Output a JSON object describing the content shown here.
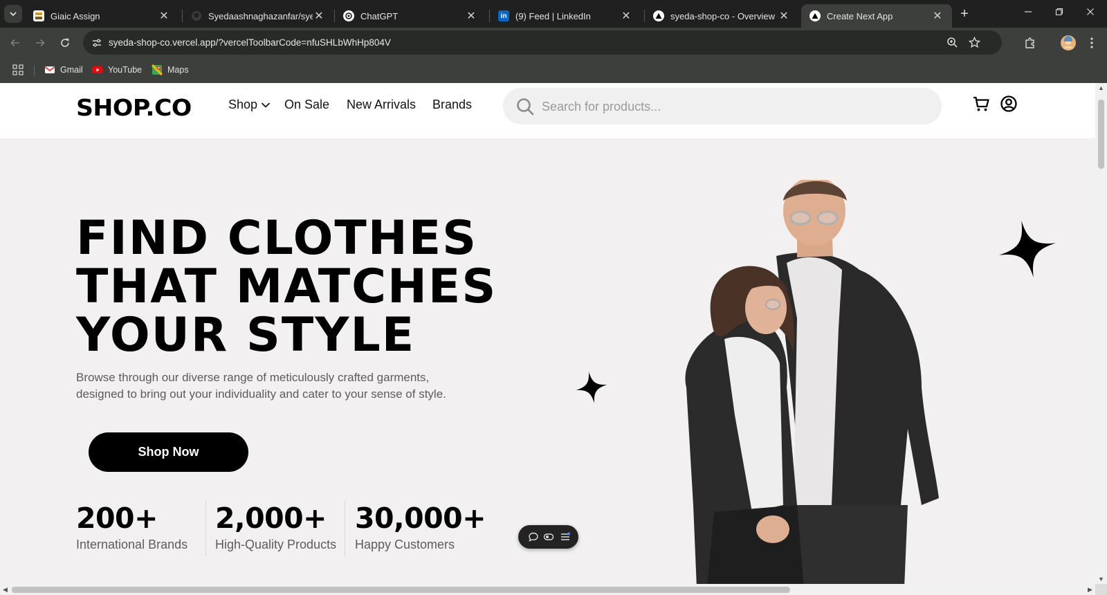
{
  "browser": {
    "tabs": [
      {
        "title": "Giaic Assign",
        "favicon": "giaic-favicon",
        "active": false
      },
      {
        "title": "Syedaashnaghazanfar/syeda-shop-co",
        "favicon": "github-favicon",
        "active": false
      },
      {
        "title": "ChatGPT",
        "favicon": "chatgpt-favicon",
        "active": false
      },
      {
        "title": "(9) Feed | LinkedIn",
        "favicon": "linkedin-favicon",
        "active": false
      },
      {
        "title": "syeda-shop-co - Overview – Vercel",
        "favicon": "vercel-favicon",
        "active": false
      },
      {
        "title": "Create Next App",
        "favicon": "vercel-favicon",
        "active": true
      }
    ],
    "url": "syeda-shop-co.vercel.app/?vercelToolbarCode=nfuSHLbWhHp804V",
    "bookmarks": [
      {
        "label": "Gmail",
        "icon": "gmail-icon"
      },
      {
        "label": "YouTube",
        "icon": "youtube-icon"
      },
      {
        "label": "Maps",
        "icon": "maps-icon"
      }
    ]
  },
  "site": {
    "logo": "SHOP.CO",
    "nav": {
      "shop": "Shop",
      "on_sale": "On Sale",
      "new_arrivals": "New Arrivals",
      "brands": "Brands"
    },
    "search": {
      "placeholder": "Search for products..."
    },
    "hero": {
      "title_lines": [
        "FIND CLOTHES",
        "THAT MATCHES",
        "YOUR STYLE"
      ],
      "description": "Browse through our diverse range of meticulously crafted garments, designed to bring out your individuality and cater to your sense of style.",
      "cta": "Shop Now"
    },
    "stats": [
      {
        "value": "200+",
        "label": "International Brands"
      },
      {
        "value": "2,000+",
        "label": "High-Quality Products"
      },
      {
        "value": "30,000+",
        "label": "Happy Customers"
      }
    ]
  },
  "colors": {
    "hero_bg": "#f2f0f1",
    "accent": "#000000",
    "chrome_dark": "#1f201f",
    "chrome_toolbar": "#3c3f3c"
  }
}
